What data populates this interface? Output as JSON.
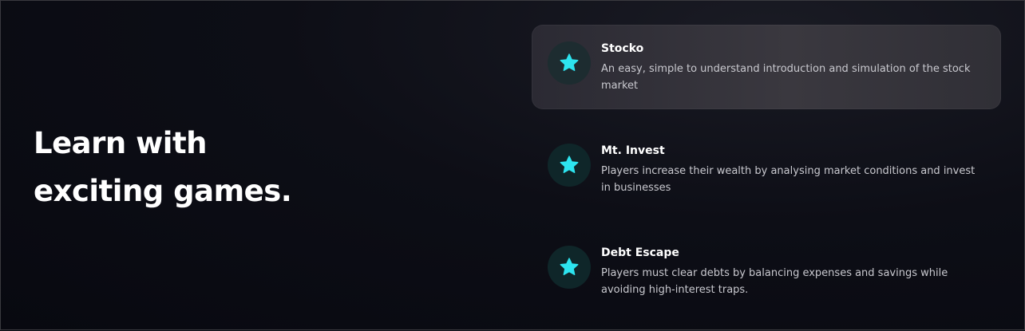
{
  "headline": {
    "line1": "Learn with",
    "line2": "exciting games."
  },
  "games": [
    {
      "title": "Stocko",
      "description": "An easy, simple to understand introduction and simulation of the stock market",
      "icon": "star-icon",
      "active": true
    },
    {
      "title": "Mt. Invest",
      "description": "Players increase their wealth by analysing market conditions and invest in businesses",
      "icon": "star-icon",
      "active": false
    },
    {
      "title": "Debt Escape",
      "description": "Players must clear debts by balancing expenses and savings while avoiding high-interest traps.",
      "icon": "star-icon",
      "active": false
    }
  ],
  "colors": {
    "accent": "#2de4ef",
    "background": "#0b0c13",
    "active_card": "#35343b"
  }
}
